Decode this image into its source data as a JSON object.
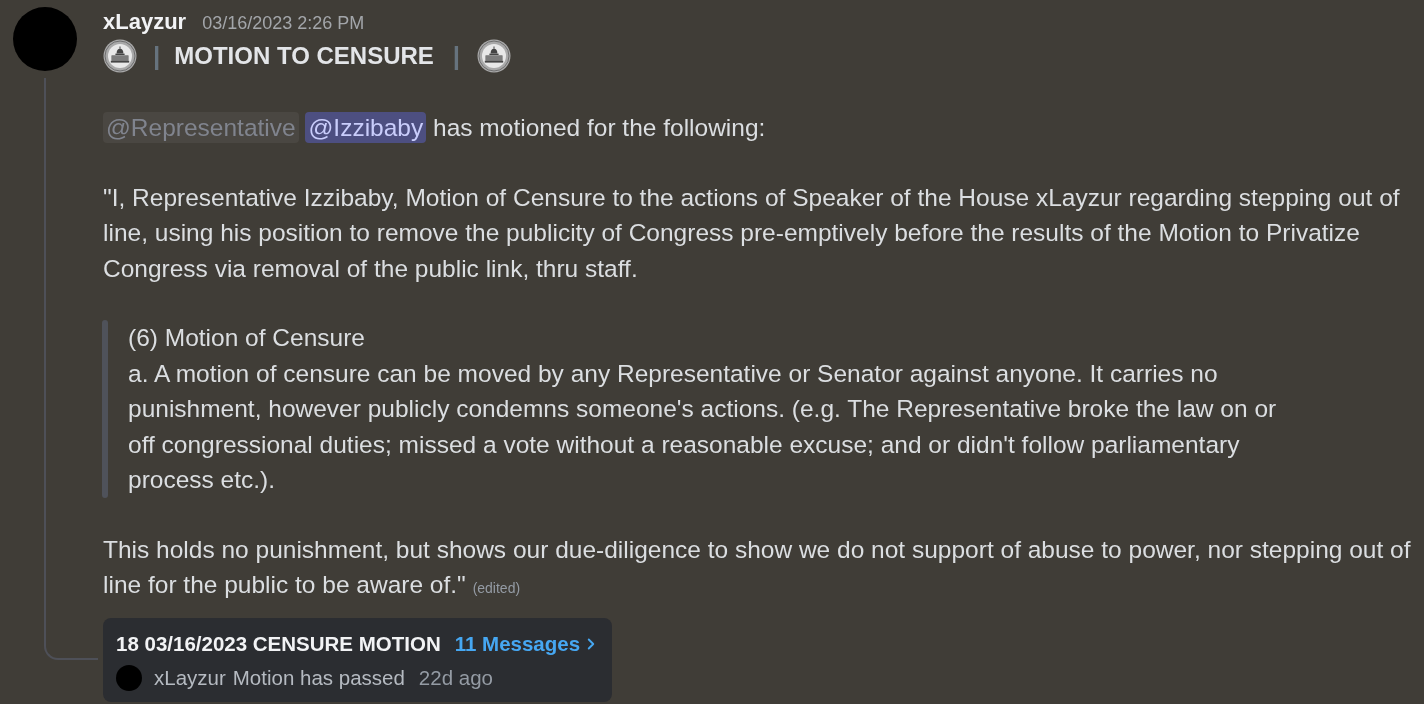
{
  "message": {
    "author": "xLayzur",
    "timestamp": "03/16/2023 2:26 PM",
    "heading": {
      "left_separator": "|",
      "title": "MOTION TO CENSURE",
      "right_separator": "|"
    },
    "intro": {
      "mentions": [
        {
          "kind": "role",
          "text": "@Representative"
        },
        {
          "kind": "user",
          "text": "@Izzibaby"
        }
      ],
      "text": "has motioned for the following:"
    },
    "paragraph": "\"I, Representative Izzibaby, Motion of Censure to the actions of Speaker of the House xLayzur regarding stepping out of line, using his position to remove the publicity of Congress pre-emptively before the results of the Motion to Privatize Congress via removal of the public link, thru staff.",
    "quote": {
      "title": "(6) Motion of Censure",
      "text": "a. A motion of censure can be moved by any Representative or Senator against anyone. It carries no punishment, however publicly condemns someone's actions. (e.g. The Representative broke the law on or off congressional duties; missed a vote without a reasonable excuse; and or didn't follow parliamentary process etc.)."
    },
    "closing": "This holds no punishment, but shows our due-diligence to show we do not support of abuse to power, nor stepping out of line for the public to be aware of.\"",
    "edited": "(edited)"
  },
  "thread": {
    "title": "18 03/16/2023 CENSURE MOTION",
    "link": "11 Messages",
    "last_author": "xLayzur",
    "last_message": "Motion has passed",
    "time": "22d ago"
  }
}
